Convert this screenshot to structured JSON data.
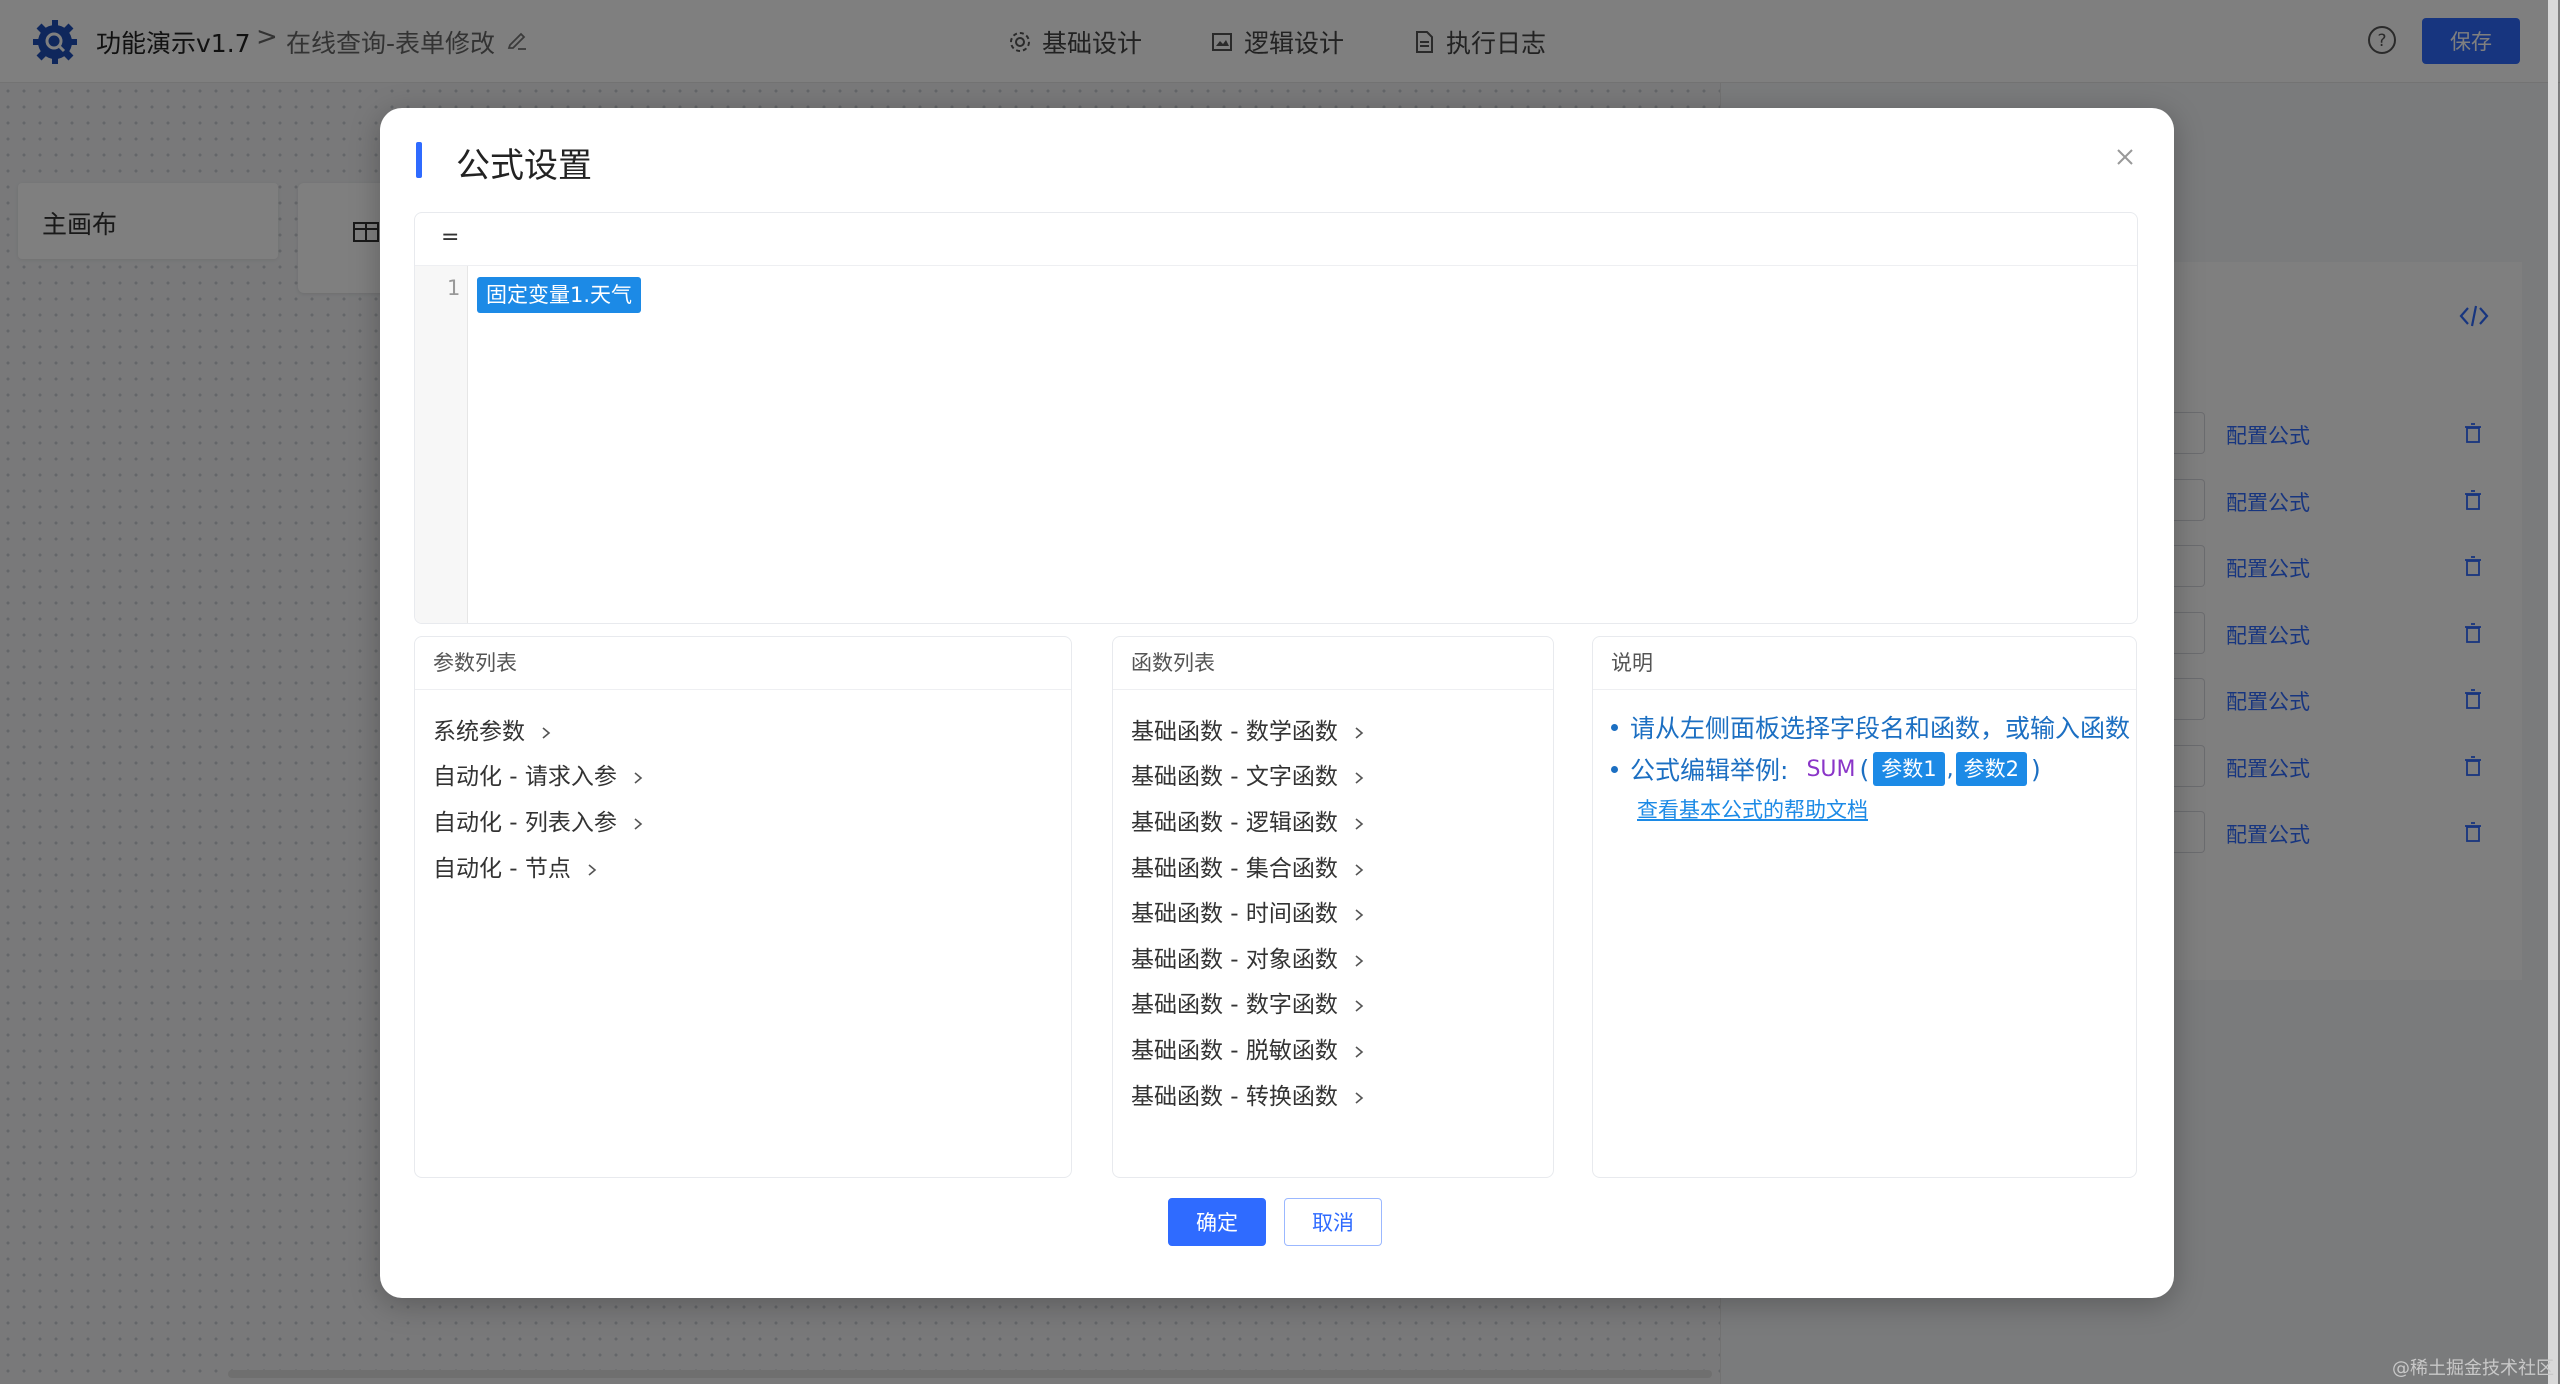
{
  "app": {
    "title": "功能演示v1.7",
    "breadcrumb_sep": ">",
    "breadcrumb": "在线查询-表单修改",
    "tabs": [
      {
        "label": "基础设计",
        "icon": "gear-icon"
      },
      {
        "label": "逻辑设计",
        "icon": "image-icon"
      },
      {
        "label": "执行日志",
        "icon": "document-icon"
      }
    ],
    "save_label": "保存"
  },
  "canvas": {
    "main_label": "主画布"
  },
  "right_panel": {
    "formula_link": "配置公式",
    "row_count": 7
  },
  "modal": {
    "title": "公式设置",
    "editor": {
      "prefix": "=",
      "line_number": "1",
      "token": "固定变量1.天气"
    },
    "params": {
      "title": "参数列表",
      "items": [
        "系统参数",
        "自动化 - 请求入参",
        "自动化 - 列表入参",
        "自动化 - 节点"
      ]
    },
    "functions": {
      "title": "函数列表",
      "items": [
        "基础函数 - 数学函数",
        "基础函数 - 文字函数",
        "基础函数 - 逻辑函数",
        "基础函数 - 集合函数",
        "基础函数 - 时间函数",
        "基础函数 - 对象函数",
        "基础函数 - 数字函数",
        "基础函数 - 脱敏函数",
        "基础函数 - 转换函数"
      ]
    },
    "description": {
      "title": "说明",
      "line1": "请从左侧面板选择字段名和函数，或输入函数",
      "line2_label": "公式编辑举例:",
      "sum": "SUM",
      "paren_open": "(",
      "arg1": "参数1",
      "comma": ",",
      "arg2": "参数2",
      "paren_close": ")",
      "help_link": "查看基本公式的帮助文档"
    },
    "confirm_label": "确定",
    "cancel_label": "取消"
  },
  "watermark": "@稀土掘金技术社区",
  "colors": {
    "accent": "#2f6bff",
    "token": "#1c8ae6",
    "desc_text": "#1c6fc2",
    "sum_keyword": "#8a35c8"
  }
}
